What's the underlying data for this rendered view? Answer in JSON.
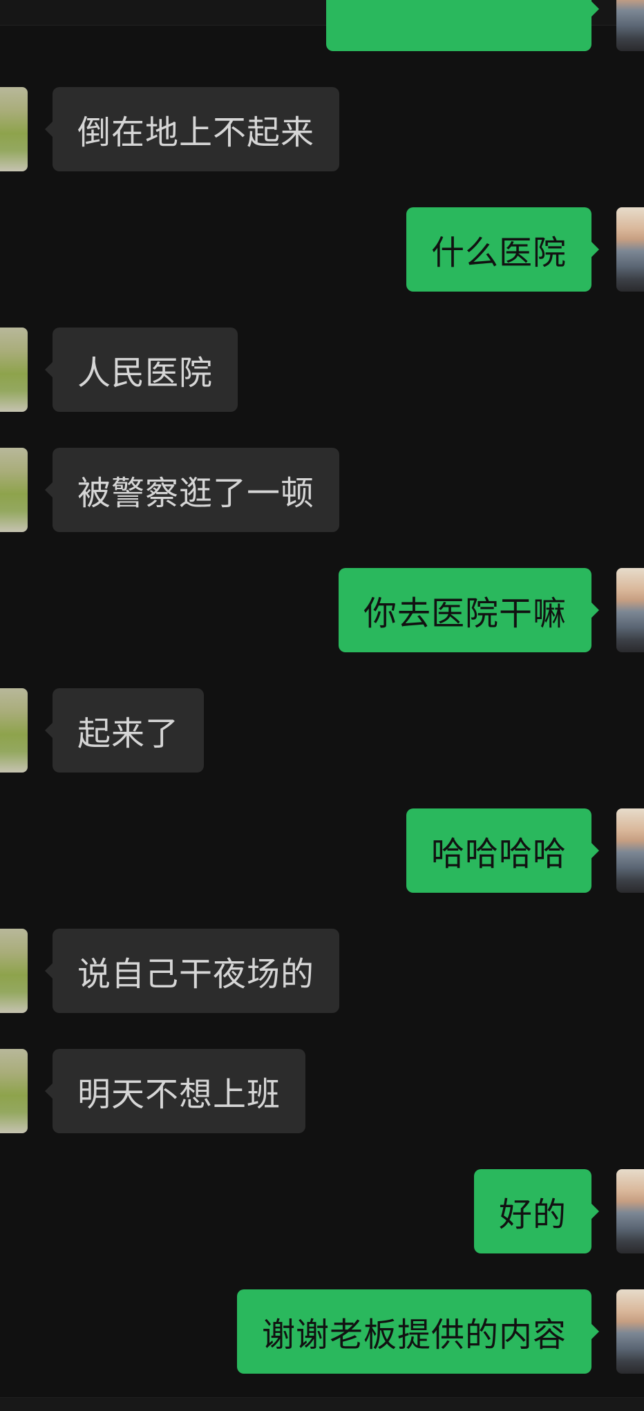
{
  "colors": {
    "background": "#111111",
    "incoming_bubble": "#2c2c2c",
    "outgoing_bubble": "#2ab85d",
    "incoming_text": "#d6d6d6",
    "outgoing_text": "#111111"
  },
  "messages": [
    {
      "direction": "in",
      "text": "倒在地上不起来"
    },
    {
      "direction": "out",
      "text": "什么医院"
    },
    {
      "direction": "in",
      "text": "人民医院"
    },
    {
      "direction": "in",
      "text": "被警察逛了一顿"
    },
    {
      "direction": "out",
      "text": "你去医院干嘛"
    },
    {
      "direction": "in",
      "text": "起来了"
    },
    {
      "direction": "out",
      "text": "哈哈哈哈"
    },
    {
      "direction": "in",
      "text": "说自己干夜场的"
    },
    {
      "direction": "in",
      "text": "明天不想上班"
    },
    {
      "direction": "out",
      "text": "好的"
    },
    {
      "direction": "out",
      "text": "谢谢老板提供的内容"
    }
  ],
  "avatars": {
    "incoming": "grass-photo-avatar",
    "outgoing": "sunset-sea-avatar"
  }
}
